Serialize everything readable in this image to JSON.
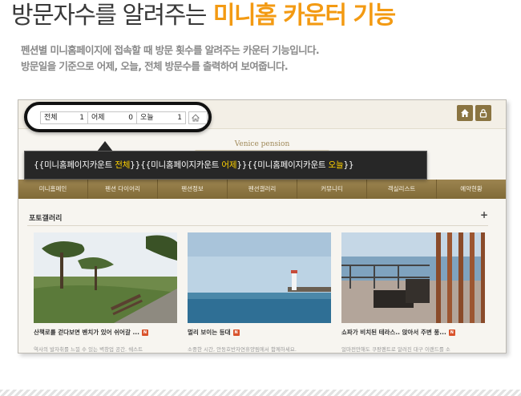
{
  "headline": {
    "plain": "방문자수를 알려주는",
    "accent": "미니홈 카운터 기능"
  },
  "description": {
    "line1": "펜션별 미니홈페이지에 접속할 때 방문 횟수를 알려주는 카운터 기능입니다.",
    "line2": "방문일을 기준으로 어제, 오늘, 전체 방문수를 출력하여 보여줍니다."
  },
  "counter": {
    "segments": [
      {
        "label": "전체",
        "value": "1"
      },
      {
        "label": "어제",
        "value": "0"
      },
      {
        "label": "오늘",
        "value": "1"
      }
    ]
  },
  "tooltip": {
    "part1_pre": "{{미니홈페이지카운트 ",
    "part1_key": "전체",
    "part1_post": "}}",
    "part2_pre": "{{미니홈페이지카운트 ",
    "part2_key": "어제",
    "part2_post": "}}",
    "part3_pre": "{{미니홈페이지카운트 ",
    "part3_key": "오늘",
    "part3_post": "}}"
  },
  "site": {
    "brand": "Venice pension",
    "nav": [
      "미니홈메인",
      "펜션 다이어리",
      "펜션정보",
      "펜션갤러리",
      "커뮤니티",
      "객실리스트",
      "예약현황"
    ],
    "gallery_title": "포토갤러리",
    "gallery_plus": "+",
    "posts": [
      {
        "title": "산책로를 걷다보면 벤치가 있어 쉬어갈 ...",
        "badge": "N",
        "excerpt": "역사의 발자취를 느낄 수 있는 벽창업 공간. 쉐스트"
      },
      {
        "title": "멀리 보이는 등대",
        "badge": "N",
        "excerpt": "소중한 시간, 안동호반자연휴양림에서 함께하세요."
      },
      {
        "title": "쇼파가 비치된 테라스.. 앉아서 주변 풍...",
        "badge": "N",
        "excerpt": "얼마전만해도 쿠팡펜트로 알려진 대구 이랜드를 소"
      }
    ]
  },
  "colors": {
    "accent": "#f39a12",
    "nav_bg": "#8f7845",
    "tooltip_bg": "#272727",
    "highlight": "#ffd200"
  },
  "icons": [
    "home-icon",
    "lock-icon",
    "home-small-icon",
    "new-badge"
  ]
}
